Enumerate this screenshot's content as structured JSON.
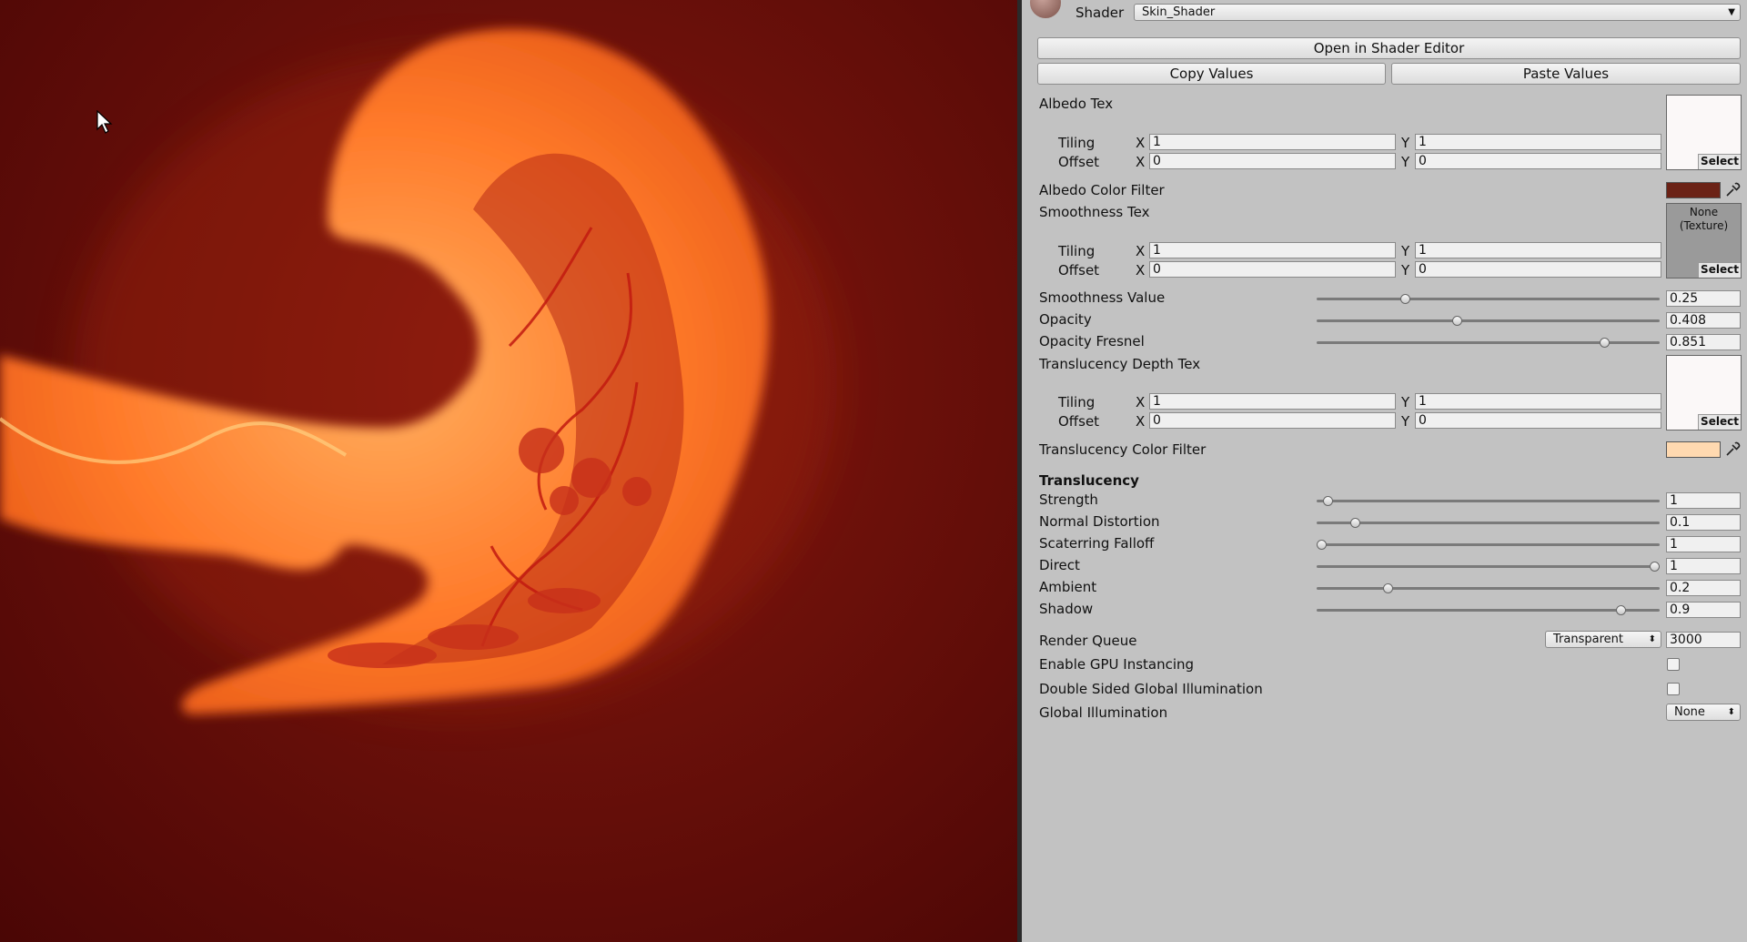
{
  "shader": {
    "label": "Shader",
    "selected": "Skin_Shader",
    "open_editor_label": "Open in Shader Editor",
    "copy_label": "Copy Values",
    "paste_label": "Paste Values"
  },
  "albedo": {
    "label": "Albedo Tex",
    "tiling_label": "Tiling",
    "offset_label": "Offset",
    "tiling_x": "1",
    "tiling_y": "1",
    "offset_x": "0",
    "offset_y": "0",
    "select_label": "Select"
  },
  "albedo_color": {
    "label": "Albedo Color Filter",
    "color": "#6b2216"
  },
  "smoothness_tex": {
    "label": "Smoothness Tex",
    "none_label": "None\n(Texture)",
    "tiling_label": "Tiling",
    "offset_label": "Offset",
    "tiling_x": "1",
    "tiling_y": "1",
    "offset_x": "0",
    "offset_y": "0",
    "select_label": "Select"
  },
  "sliders": [
    {
      "label": "Smoothness Value",
      "value": "0.25",
      "fraction": 0.25
    },
    {
      "label": "Opacity",
      "value": "0.408",
      "fraction": 0.408
    },
    {
      "label": "Opacity Fresnel",
      "value": "0.851",
      "fraction": 0.851
    }
  ],
  "translucency_depth": {
    "label": "Translucency Depth Tex",
    "tiling_label": "Tiling",
    "offset_label": "Offset",
    "tiling_x": "1",
    "tiling_y": "1",
    "offset_x": "0",
    "offset_y": "0",
    "select_label": "Select"
  },
  "translucency_color": {
    "label": "Translucency Color Filter",
    "color": "#ffd9b0"
  },
  "translucency": {
    "header": "Translucency",
    "sliders": [
      {
        "label": "Strength",
        "value": "1",
        "fraction": 0.02
      },
      {
        "label": "Normal Distortion",
        "value": "0.1",
        "fraction": 0.1
      },
      {
        "label": "Scaterring Falloff",
        "value": "1",
        "fraction": 0.0
      },
      {
        "label": "Direct",
        "value": "1",
        "fraction": 1.0
      },
      {
        "label": "Ambient",
        "value": "0.2",
        "fraction": 0.2
      },
      {
        "label": "Shadow",
        "value": "0.9",
        "fraction": 0.9
      }
    ]
  },
  "render_queue": {
    "label": "Render Queue",
    "mode": "Transparent",
    "value": "3000"
  },
  "gpu_instancing": {
    "label": "Enable GPU Instancing",
    "checked": false
  },
  "double_sided_gi": {
    "label": "Double Sided Global Illumination",
    "checked": false
  },
  "global_illumination": {
    "label": "Global Illumination",
    "value": "None"
  },
  "axis": {
    "x": "X",
    "y": "Y"
  },
  "icons": {
    "eyedropper": "eyedropper-icon",
    "cursor": "mouse-cursor-icon",
    "material": "material-preview-icon"
  }
}
